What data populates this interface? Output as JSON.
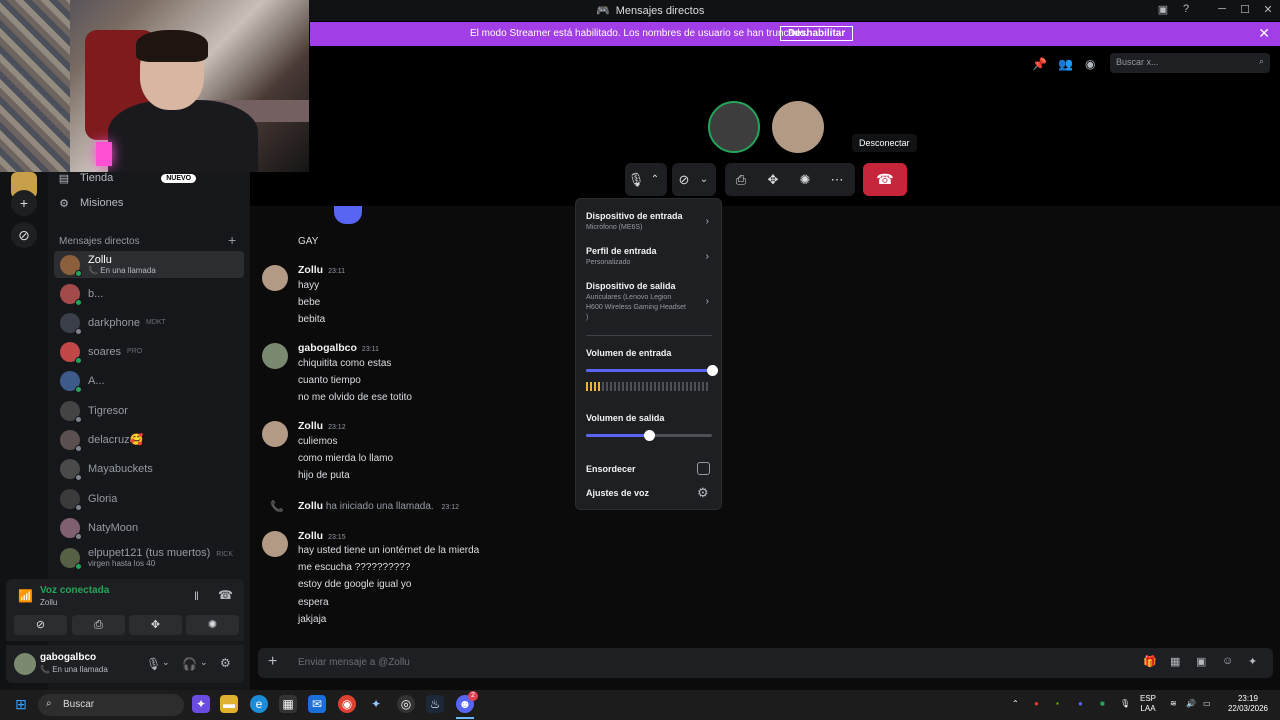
{
  "window": {
    "title": "Mensajes directos",
    "icon": "discord-icon"
  },
  "banner": {
    "message": "El modo Streamer está habilitado. Los nombres de usuario se han truncado.",
    "button": "Deshabilitar"
  },
  "sidebar": {
    "tienda": "Tienda",
    "tienda_badge": "NUEVO",
    "misiones": "Misiones",
    "dm_header": "Mensajes directos",
    "dms": [
      {
        "name": "Zollu",
        "sub": "En una llamada",
        "color": "#8b5e3c"
      },
      {
        "name": "b...",
        "sub": "",
        "color": "#a34a4a"
      },
      {
        "name": "darkphone",
        "tag": "MDKT",
        "color": "#3a3f4a"
      },
      {
        "name": "soares",
        "tag": "PRO",
        "color": "#c04848"
      },
      {
        "name": "A...",
        "tag": "",
        "color": "#3d5a8a"
      },
      {
        "name": "Tigresor",
        "tag": "",
        "color": "#444"
      },
      {
        "name": "delacruz🥰",
        "tag": "",
        "color": "#5a5050"
      },
      {
        "name": "Mayabuckets",
        "tag": "",
        "color": "#4a4a4a"
      },
      {
        "name": "Gloria",
        "tag": "",
        "color": "#3b3b3b"
      },
      {
        "name": "NatyMoon",
        "tag": "",
        "color": "#806070"
      },
      {
        "name": "elpupet121 (tus muertos)",
        "tag": "RICK",
        "sub": "virgen hasta los 40",
        "color": "#556044"
      }
    ]
  },
  "voice": {
    "status": "Voz conectada",
    "channel": "Zollu"
  },
  "user": {
    "name": "gabogalbco",
    "status": "En una llamada"
  },
  "search": {
    "placeholder": "Buscar x..."
  },
  "call": {
    "tooltip": "Desconectar"
  },
  "messages": [
    {
      "text": "GAY"
    },
    {
      "author": "Zollu",
      "time": "23:11",
      "lines": [
        "hayy",
        "bebe",
        "bebita"
      ]
    },
    {
      "author": "gabogalbco",
      "time": "23:11",
      "lines": [
        "chiquitita como estas",
        "cuanto tiempo",
        "no me olvido de ese totito"
      ]
    },
    {
      "author": "Zollu",
      "time": "23:12",
      "lines": [
        "culiemos",
        "como mierda lo llamo",
        "hijo de puta"
      ]
    },
    {
      "system_author": "Zollu",
      "system_text": "ha iniciado una llamada.",
      "system_time": "23:12"
    },
    {
      "author": "Zollu",
      "time": "23:15",
      "lines": [
        "hay usted tiene un iontérnet de la mierda",
        "me escucha ??????????",
        "estoy dde google igual yo",
        "espera",
        "jakjaja"
      ]
    }
  ],
  "composer": {
    "placeholder": "Enviar mensaje a @Zollu"
  },
  "audio_popup": {
    "input_device": {
      "label": "Dispositivo de entrada",
      "value": "Micrófono (ME6S)"
    },
    "input_profile": {
      "label": "Perfil de entrada",
      "value": "Personalizado"
    },
    "output_device": {
      "label": "Dispositivo de salida",
      "value": "Auriculares (Lenovo Legion H600 Wireless Gaming Headset )"
    },
    "input_volume": {
      "label": "Volumen de entrada",
      "value": 1.0
    },
    "output_volume": {
      "label": "Volumen de salida",
      "value": 0.5
    },
    "deafen": "Ensordecer",
    "voice_settings": "Ajustes de voz"
  },
  "taskbar": {
    "search": "Buscar",
    "lang": "ESP",
    "lang2": "LAA",
    "time": "23:19",
    "date": "22/03/2026",
    "badge": "2"
  }
}
